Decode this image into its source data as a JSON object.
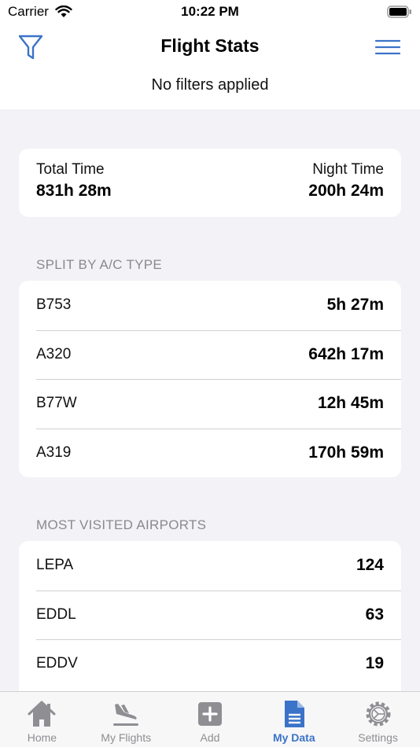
{
  "status_bar": {
    "carrier": "Carrier",
    "time": "10:22 PM"
  },
  "header": {
    "title": "Flight Stats",
    "filter_status": "No filters applied"
  },
  "totals": {
    "total_label": "Total Time",
    "total_value": "831h 28m",
    "night_label": "Night Time",
    "night_value": "200h 24m"
  },
  "aircraft_section": {
    "header": "SPLIT BY A/C TYPE",
    "rows": [
      {
        "label": "B753",
        "value": "5h 27m"
      },
      {
        "label": "A320",
        "value": "642h 17m"
      },
      {
        "label": "B77W",
        "value": "12h 45m"
      },
      {
        "label": "A319",
        "value": "170h 59m"
      }
    ]
  },
  "airports_section": {
    "header": "MOST VISITED AIRPORTS",
    "rows": [
      {
        "label": "LEPA",
        "value": "124"
      },
      {
        "label": "EDDL",
        "value": "63"
      },
      {
        "label": "EDDV",
        "value": "19"
      }
    ]
  },
  "tabbar": {
    "items": [
      {
        "label": "Home",
        "icon": "home-icon"
      },
      {
        "label": "My Flights",
        "icon": "plane-landing-icon"
      },
      {
        "label": "Add",
        "icon": "add-icon"
      },
      {
        "label": "My Data",
        "icon": "document-icon",
        "active": true
      },
      {
        "label": "Settings",
        "icon": "gear-icon"
      }
    ]
  },
  "colors": {
    "accent": "#3b73c9",
    "background": "#f2f2f7",
    "inactive": "#8e8e93"
  }
}
